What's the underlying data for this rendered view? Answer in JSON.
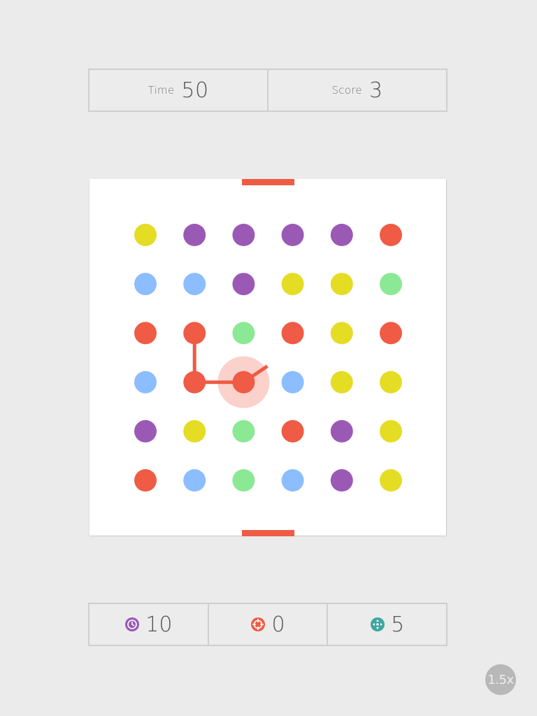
{
  "colors": {
    "red": "#ef5b45",
    "purple": "#9b59b6",
    "yellow": "#e5dc24",
    "blue": "#8bbdff",
    "green": "#8be894",
    "clock": "#9b59b6",
    "target": "#ef5b45",
    "expander": "#3fa6a0"
  },
  "stats": {
    "time_label": "Time",
    "time_value": "50",
    "score_label": "Score",
    "score_value": "3"
  },
  "board": {
    "rows": [
      [
        "yellow",
        "purple",
        "purple",
        "purple",
        "purple",
        "red"
      ],
      [
        "blue",
        "blue",
        "purple",
        "yellow",
        "yellow",
        "green"
      ],
      [
        "red",
        "red",
        "green",
        "red",
        "yellow",
        "red"
      ],
      [
        "blue",
        "red",
        "red",
        "blue",
        "yellow",
        "yellow"
      ],
      [
        "purple",
        "yellow",
        "green",
        "red",
        "purple",
        "yellow"
      ],
      [
        "red",
        "blue",
        "green",
        "blue",
        "purple",
        "yellow"
      ]
    ],
    "selection_color": "red",
    "selected_path": [
      [
        2,
        1
      ],
      [
        3,
        1
      ],
      [
        3,
        2
      ]
    ],
    "active_dot": [
      3,
      2
    ]
  },
  "powerups": [
    {
      "icon": "clock-icon",
      "count": "10",
      "color": "clock"
    },
    {
      "icon": "target-icon",
      "count": "0",
      "color": "target"
    },
    {
      "icon": "expander-icon",
      "count": "5",
      "color": "expander"
    }
  ],
  "speed_label": "1.5x"
}
